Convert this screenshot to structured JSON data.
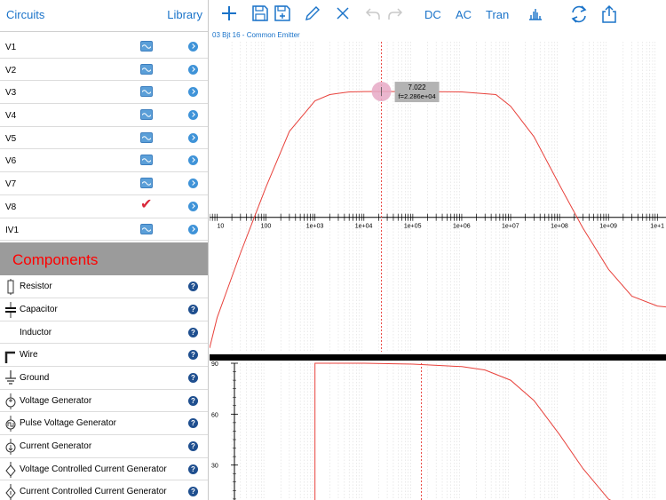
{
  "sidebar": {
    "circuits_label": "Circuits",
    "library_label": "Library",
    "sources": [
      {
        "label": "V1",
        "state": "wave"
      },
      {
        "label": "V2",
        "state": "wave"
      },
      {
        "label": "V3",
        "state": "wave"
      },
      {
        "label": "V4",
        "state": "wave"
      },
      {
        "label": "V5",
        "state": "wave"
      },
      {
        "label": "V6",
        "state": "wave"
      },
      {
        "label": "V7",
        "state": "wave"
      },
      {
        "label": "V8",
        "state": "checked"
      },
      {
        "label": "IV1",
        "state": "wave"
      }
    ],
    "components_header": "Components",
    "components": [
      {
        "label": "Resistor",
        "icon": "resistor-icon"
      },
      {
        "label": "Capacitor",
        "icon": "capacitor-icon"
      },
      {
        "label": "Inductor",
        "icon": "inductor-icon"
      },
      {
        "label": "Wire",
        "icon": "wire-icon"
      },
      {
        "label": "Ground",
        "icon": "ground-icon"
      },
      {
        "label": "Voltage Generator",
        "icon": "voltage-generator-icon"
      },
      {
        "label": "Pulse Voltage Generator",
        "icon": "pulse-generator-icon"
      },
      {
        "label": "Current Generator",
        "icon": "current-generator-icon"
      },
      {
        "label": "Voltage Controlled Current Generator",
        "icon": "vccs-icon"
      },
      {
        "label": "Current Controlled Current Generator",
        "icon": "cccs-icon"
      }
    ]
  },
  "toolbar": {
    "dc_label": "DC",
    "ac_label": "AC",
    "tran_label": "Tran"
  },
  "circuit_title": "03 Bjt 16 - Common Emitter",
  "colors": {
    "accent": "#1a73c9",
    "trace": "#e8413b",
    "components_text": "#ff0000",
    "components_bg": "#9b9b9b"
  },
  "chart_data": [
    {
      "type": "line",
      "title": "",
      "x_scale": "log",
      "x_ticks": [
        "10",
        "100",
        "1e+03",
        "1e+04",
        "1e+05",
        "1e+06",
        "1e+07",
        "1e+08",
        "1e+09",
        "1e+1"
      ],
      "xlim": [
        7,
        15000000000
      ],
      "ylim": [
        -7.5,
        9.8
      ],
      "x": [
        7,
        10,
        30,
        100,
        300,
        1000,
        2000,
        5000,
        10000,
        22860,
        100000,
        1000000,
        5000000,
        10000000,
        30000000,
        100000000,
        300000000,
        1000000000,
        3000000000,
        10000000000,
        15000000000
      ],
      "y": [
        -7.3,
        -5.6,
        -2.0,
        1.7,
        4.8,
        6.5,
        6.85,
        7.0,
        7.02,
        7.022,
        7.02,
        7.0,
        6.85,
        6.2,
        4.5,
        1.8,
        -0.6,
        -2.9,
        -4.4,
        -4.95,
        -5.0
      ],
      "cursor": {
        "x": 22860,
        "value_label": "7.022",
        "freq_label": "f=2.286e+04"
      }
    },
    {
      "type": "line",
      "title": "",
      "x_scale": "log",
      "xlim": [
        7,
        15000000000
      ],
      "ylim": [
        0,
        90
      ],
      "y_ticks": [
        "90",
        "60",
        "30"
      ],
      "x": [
        1000,
        1000,
        10000,
        100000,
        1000000,
        3000000,
        10000000,
        30000000,
        100000000,
        300000000,
        1000000000,
        3000000000,
        10000000000
      ],
      "y": [
        0,
        90,
        90,
        89.5,
        88,
        86,
        80,
        68,
        48,
        28,
        10,
        2,
        0
      ],
      "cursor_x": 150000
    }
  ]
}
